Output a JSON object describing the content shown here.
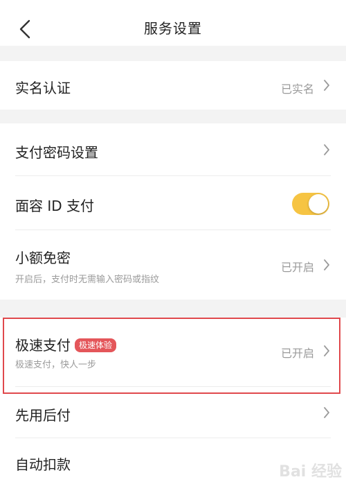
{
  "header": {
    "title": "服务设置"
  },
  "rows": {
    "real_name": {
      "label": "实名认证",
      "value": "已实名"
    },
    "pay_password": {
      "label": "支付密码设置"
    },
    "face_id": {
      "label": "面容 ID 支付",
      "toggle_on": true
    },
    "small_amount": {
      "label": "小额免密",
      "sub": "开启后，支付时无需输入密码或指纹",
      "value": "已开启"
    },
    "fast_pay": {
      "label": "极速支付",
      "badge": "极速体验",
      "sub": "极速支付，快人一步",
      "value": "已开启"
    },
    "pay_later": {
      "label": "先用后付"
    },
    "auto_debit": {
      "label": "自动扣款"
    }
  },
  "colors": {
    "toggle_on": "#f6c443",
    "badge": "#e4565a",
    "highlight": "#e0484c",
    "gap": "#f3f3f3"
  },
  "watermark": "Bai 经验"
}
